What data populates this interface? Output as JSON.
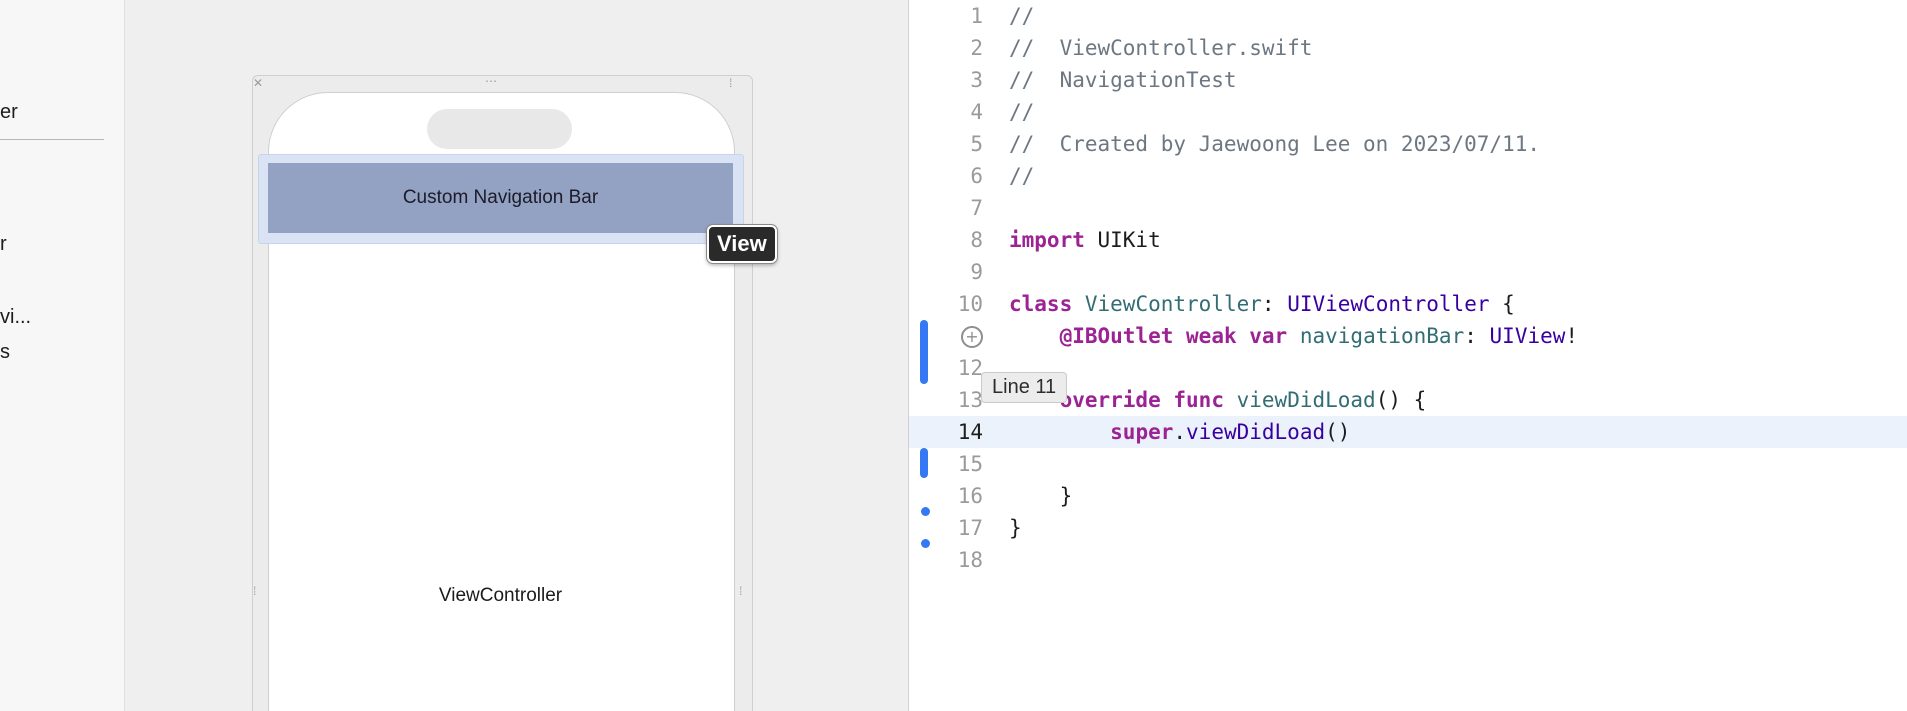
{
  "outline": {
    "items": [
      "er",
      "r",
      "vi...",
      "s"
    ]
  },
  "canvas": {
    "nav_bar_label": "Custom Navigation Bar",
    "controller_label": "ViewController",
    "selection_tooltip": "View"
  },
  "editor": {
    "lines": [
      {
        "n": "1",
        "tokens": [
          {
            "t": "//",
            "c": "comment"
          }
        ]
      },
      {
        "n": "2",
        "tokens": [
          {
            "t": "//  ViewController.swift",
            "c": "comment"
          }
        ]
      },
      {
        "n": "3",
        "tokens": [
          {
            "t": "//  NavigationTest",
            "c": "comment"
          }
        ]
      },
      {
        "n": "4",
        "tokens": [
          {
            "t": "//",
            "c": "comment"
          }
        ]
      },
      {
        "n": "5",
        "tokens": [
          {
            "t": "//  Created by Jaewoong Lee on 2023/07/11.",
            "c": "comment"
          }
        ]
      },
      {
        "n": "6",
        "tokens": [
          {
            "t": "//",
            "c": "comment"
          }
        ]
      },
      {
        "n": "7",
        "tokens": []
      },
      {
        "n": "8",
        "tokens": [
          {
            "t": "import",
            "c": "keyword"
          },
          {
            "t": " UIKit",
            "c": "plain"
          }
        ]
      },
      {
        "n": "9",
        "tokens": []
      },
      {
        "n": "10",
        "tokens": [
          {
            "t": "class",
            "c": "keyword"
          },
          {
            "t": " ",
            "c": "plain"
          },
          {
            "t": "ViewController",
            "c": "ident"
          },
          {
            "t": ": ",
            "c": "plain"
          },
          {
            "t": "UIViewController",
            "c": "type"
          },
          {
            "t": " {",
            "c": "plain"
          }
        ]
      },
      {
        "n": "",
        "tokens": [
          {
            "t": "    ",
            "c": "plain"
          },
          {
            "t": "@IBOutlet",
            "c": "keyword"
          },
          {
            "t": " ",
            "c": "plain"
          },
          {
            "t": "weak",
            "c": "keyword"
          },
          {
            "t": " ",
            "c": "plain"
          },
          {
            "t": "var",
            "c": "keyword"
          },
          {
            "t": " ",
            "c": "plain"
          },
          {
            "t": "navigationBar",
            "c": "ident"
          },
          {
            "t": ": ",
            "c": "plain"
          },
          {
            "t": "UIView",
            "c": "type"
          },
          {
            "t": "!",
            "c": "plain"
          }
        ]
      },
      {
        "n": "12",
        "tokens": []
      },
      {
        "n": "13",
        "tokens": [
          {
            "t": "    ",
            "c": "plain"
          },
          {
            "t": "override",
            "c": "keyword"
          },
          {
            "t": " ",
            "c": "plain"
          },
          {
            "t": "func",
            "c": "keyword"
          },
          {
            "t": " ",
            "c": "plain"
          },
          {
            "t": "viewDidLoad",
            "c": "ident"
          },
          {
            "t": "() {",
            "c": "plain"
          }
        ]
      },
      {
        "n": "14",
        "current": true,
        "tokens": [
          {
            "t": "        ",
            "c": "plain"
          },
          {
            "t": "super",
            "c": "keyword"
          },
          {
            "t": ".",
            "c": "plain"
          },
          {
            "t": "viewDidLoad",
            "c": "type"
          },
          {
            "t": "()",
            "c": "plain"
          }
        ]
      },
      {
        "n": "15",
        "tokens": []
      },
      {
        "n": "16",
        "tokens": [
          {
            "t": "    }",
            "c": "plain"
          }
        ]
      },
      {
        "n": "17",
        "tokens": [
          {
            "t": "}",
            "c": "plain"
          }
        ]
      },
      {
        "n": "18",
        "tokens": []
      }
    ],
    "line_tooltip": "Line 11",
    "outlet_icon": "plus-circle-icon"
  },
  "colors": {
    "keyword": "#9b2393",
    "comment": "#6d7781",
    "type": "#3900a0",
    "ident": "#326d74",
    "change_indicator": "#3478f6",
    "nav_bar_fill": "#93a2c2"
  }
}
